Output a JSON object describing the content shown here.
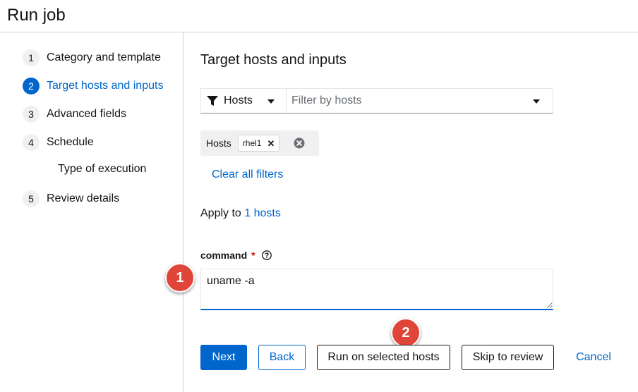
{
  "page": {
    "title": "Run job"
  },
  "wizard_nav": {
    "items": [
      {
        "number": "1",
        "label": "Category and template"
      },
      {
        "number": "2",
        "label": "Target hosts and inputs",
        "active": true
      },
      {
        "number": "3",
        "label": "Advanced fields"
      },
      {
        "number": "4",
        "label": "Schedule"
      },
      {
        "number": "5",
        "label": "Review details"
      }
    ],
    "sub_item": "Type of execution"
  },
  "section": {
    "title": "Target hosts and inputs"
  },
  "filter": {
    "type_label": "Hosts",
    "input_placeholder": "Filter by hosts",
    "chip_group_label": "Hosts",
    "chip_value": "rhel1",
    "clear_all": "Clear all filters"
  },
  "apply": {
    "prefix": "Apply to ",
    "link": "1 hosts"
  },
  "command": {
    "label": "command",
    "required_mark": "*",
    "value": "uname -a"
  },
  "annotations": {
    "badge_1": "1",
    "badge_2": "2"
  },
  "buttons": {
    "next": "Next",
    "back": "Back",
    "run_selected": "Run on selected hosts",
    "skip_review": "Skip to review",
    "cancel": "Cancel"
  },
  "colors": {
    "accent": "#0066cc",
    "required": "#c9190b",
    "badge": "#e0453a"
  }
}
